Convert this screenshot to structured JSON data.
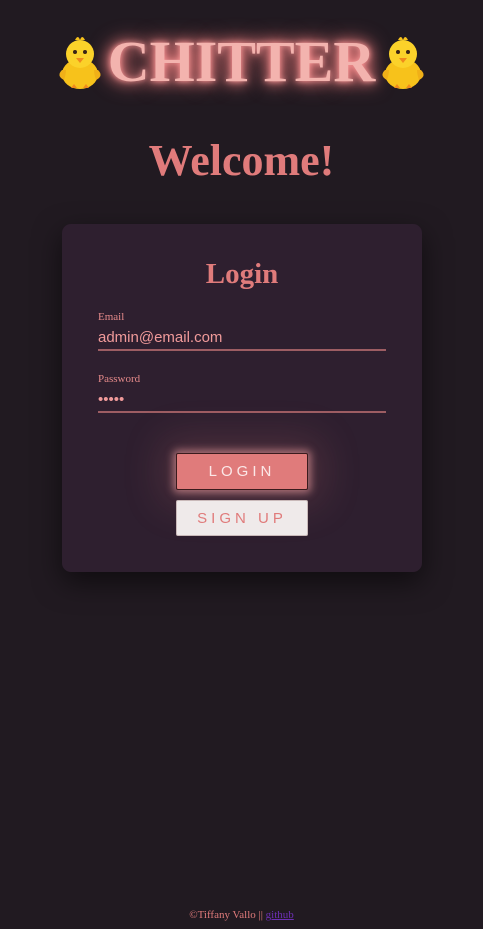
{
  "header": {
    "brand_title": "CHITTER",
    "left_icon": "chick-icon",
    "right_icon": "chick-icon"
  },
  "welcome": "Welcome!",
  "login_form": {
    "title": "Login",
    "email_label": "Email",
    "email_value": "admin@email.com",
    "password_label": "Password",
    "password_value": "•••••",
    "login_button": "LOGIN",
    "signup_button": "SIGN UP"
  },
  "footer": {
    "copyright": "©Tiffany Vallo || ",
    "link_text": "github"
  },
  "colors": {
    "background": "#211a21",
    "card": "#2e1f2f",
    "accent": "#e07b7b",
    "brand_glow": "#ff8d8d",
    "link": "#6c2fb3"
  }
}
